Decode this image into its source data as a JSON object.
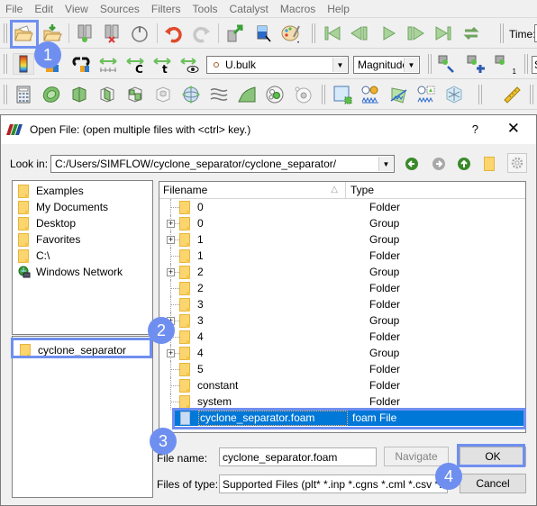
{
  "menubar": {
    "items": [
      "File",
      "Edit",
      "View",
      "Sources",
      "Filters",
      "Tools",
      "Catalyst",
      "Macros",
      "Help"
    ]
  },
  "toolbar": {
    "time_label": "Time:",
    "array_combo": {
      "value": "U.bulk",
      "icon": "point-data-icon"
    },
    "component_combo": {
      "value": "Magnitude"
    },
    "camera_count": "1",
    "partial_combo_char": "S"
  },
  "annotations": {
    "step1": "1",
    "step2": "2",
    "step3": "3",
    "step4": "4",
    "color": "#6f8ff0"
  },
  "dialog": {
    "title": "Open File:  (open multiple files with <ctrl> key.)",
    "help_label": "?",
    "close_label": "✕",
    "look_in_label": "Look in:",
    "look_in_value": "C:/Users/SIMFLOW/cyclone_separator/cyclone_separator/",
    "sidebar": {
      "places": [
        {
          "label": "Examples",
          "icon": "folder-icon"
        },
        {
          "label": "My Documents",
          "icon": "folder-icon"
        },
        {
          "label": "Desktop",
          "icon": "folder-icon"
        },
        {
          "label": "Favorites",
          "icon": "folder-icon"
        },
        {
          "label": "C:\\",
          "icon": "folder-icon"
        },
        {
          "label": "Windows Network",
          "icon": "network-icon"
        }
      ],
      "recent": [
        {
          "label": "cyclone_separator",
          "icon": "folder-icon"
        }
      ]
    },
    "file_list": {
      "columns": [
        "Filename",
        "Type"
      ],
      "rows": [
        {
          "name": "0",
          "type": "Folder",
          "expandable": false
        },
        {
          "name": "0",
          "type": "Group",
          "expandable": true
        },
        {
          "name": "1",
          "type": "Group",
          "expandable": true
        },
        {
          "name": "1",
          "type": "Folder",
          "expandable": false
        },
        {
          "name": "2",
          "type": "Group",
          "expandable": true
        },
        {
          "name": "2",
          "type": "Folder",
          "expandable": false
        },
        {
          "name": "3",
          "type": "Folder",
          "expandable": false
        },
        {
          "name": "3",
          "type": "Group",
          "expandable": true
        },
        {
          "name": "4",
          "type": "Folder",
          "expandable": false
        },
        {
          "name": "4",
          "type": "Group",
          "expandable": true
        },
        {
          "name": "5",
          "type": "Folder",
          "expandable": false
        },
        {
          "name": "constant",
          "type": "Folder",
          "expandable": false
        },
        {
          "name": "system",
          "type": "Folder",
          "expandable": false
        }
      ],
      "selected": {
        "name": "cyclone_separator.foam",
        "type": "foam File"
      }
    },
    "file_name_label": "File name:",
    "file_name_value": "cyclone_separator.foam",
    "files_of_type_label": "Files of type:",
    "files_of_type_value": "Supported Files (plt* *.inp *.cgns *.cml *.csv *.t",
    "navigate_label": "Navigate",
    "ok_label": "OK",
    "cancel_label": "Cancel"
  },
  "colors": {
    "selection": "#0078d7",
    "highlight": "#6f8ff0",
    "folder": "#fbd56e"
  }
}
